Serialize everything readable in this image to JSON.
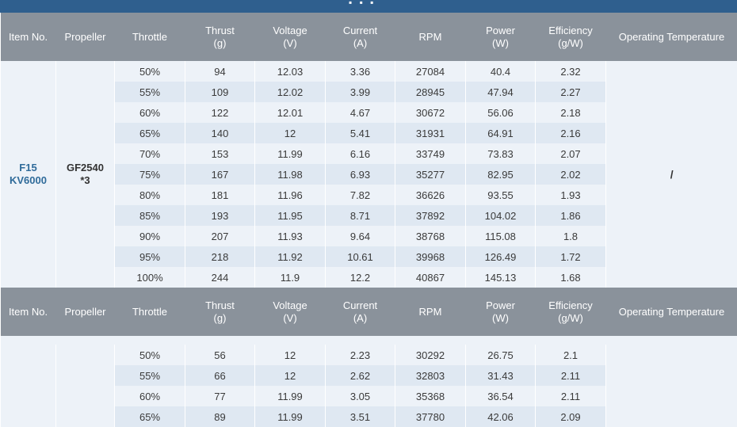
{
  "banner": {
    "glyphs": "▪ ▪ ▪"
  },
  "headers": [
    {
      "line1": "Item No.",
      "line2": ""
    },
    {
      "line1": "Propeller",
      "line2": ""
    },
    {
      "line1": "Throttle",
      "line2": ""
    },
    {
      "line1": "Thrust",
      "line2": "(g)"
    },
    {
      "line1": "Voltage",
      "line2": "(V)"
    },
    {
      "line1": "Current",
      "line2": "(A)"
    },
    {
      "line1": "RPM",
      "line2": ""
    },
    {
      "line1": "Power",
      "line2": "(W)"
    },
    {
      "line1": "Efficiency",
      "line2": "(g/W)"
    },
    {
      "line1": "Operating Temperature",
      "line2": ""
    }
  ],
  "section1": {
    "item": {
      "line1": "F15",
      "line2": "KV6000"
    },
    "propeller": {
      "line1": "GF2540",
      "line2": "*3"
    },
    "temperature": "/",
    "rows": [
      [
        "50%",
        "94",
        "12.03",
        "3.36",
        "27084",
        "40.4",
        "2.32"
      ],
      [
        "55%",
        "109",
        "12.02",
        "3.99",
        "28945",
        "47.94",
        "2.27"
      ],
      [
        "60%",
        "122",
        "12.01",
        "4.67",
        "30672",
        "56.06",
        "2.18"
      ],
      [
        "65%",
        "140",
        "12",
        "5.41",
        "31931",
        "64.91",
        "2.16"
      ],
      [
        "70%",
        "153",
        "11.99",
        "6.16",
        "33749",
        "73.83",
        "2.07"
      ],
      [
        "75%",
        "167",
        "11.98",
        "6.93",
        "35277",
        "82.95",
        "2.02"
      ],
      [
        "80%",
        "181",
        "11.96",
        "7.82",
        "36626",
        "93.55",
        "1.93"
      ],
      [
        "85%",
        "193",
        "11.95",
        "8.71",
        "37892",
        "104.02",
        "1.86"
      ],
      [
        "90%",
        "207",
        "11.93",
        "9.64",
        "38768",
        "115.08",
        "1.8"
      ],
      [
        "95%",
        "218",
        "11.92",
        "10.61",
        "39968",
        "126.49",
        "1.72"
      ],
      [
        "100%",
        "244",
        "11.9",
        "12.2",
        "40867",
        "145.13",
        "1.68"
      ]
    ]
  },
  "section2": {
    "rows": [
      [
        "50%",
        "56",
        "12",
        "2.23",
        "30292",
        "26.75",
        "2.1"
      ],
      [
        "55%",
        "66",
        "12",
        "2.62",
        "32803",
        "31.43",
        "2.11"
      ],
      [
        "60%",
        "77",
        "11.99",
        "3.05",
        "35368",
        "36.54",
        "2.11"
      ],
      [
        "65%",
        "89",
        "11.99",
        "3.51",
        "37780",
        "42.06",
        "2.09"
      ]
    ]
  }
}
